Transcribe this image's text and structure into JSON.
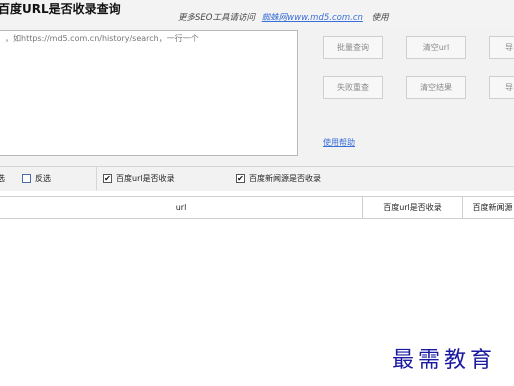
{
  "window": {
    "title": "百度URL是否收录查询",
    "promo_text": "更多SEO工具请访问",
    "promo_link": "蜘蛛网www.md5.com.cn",
    "promo_suffix": "使用"
  },
  "input": {
    "placeholder": "，如https://md5.com.cn/history/search，一行一个"
  },
  "buttons": {
    "batch_query": "批量查询",
    "clear_url": "清空url",
    "export": "导",
    "failed_requery": "失败重查",
    "clear_results": "清空结果",
    "right_edge_2": "导"
  },
  "help_link": "使用帮助",
  "options": {
    "select_all_partial": "选",
    "invert": "反选",
    "baidu_url_indexed": "百度url是否收录",
    "baidu_news_indexed": "百度新闻源是否收录"
  },
  "table": {
    "columns": [
      "url",
      "百度url是否收录",
      "百度新闻源"
    ]
  },
  "watermark": "最需教育",
  "colors": {
    "link": "#3a6fd8",
    "watermark": "#1a1aa0"
  }
}
